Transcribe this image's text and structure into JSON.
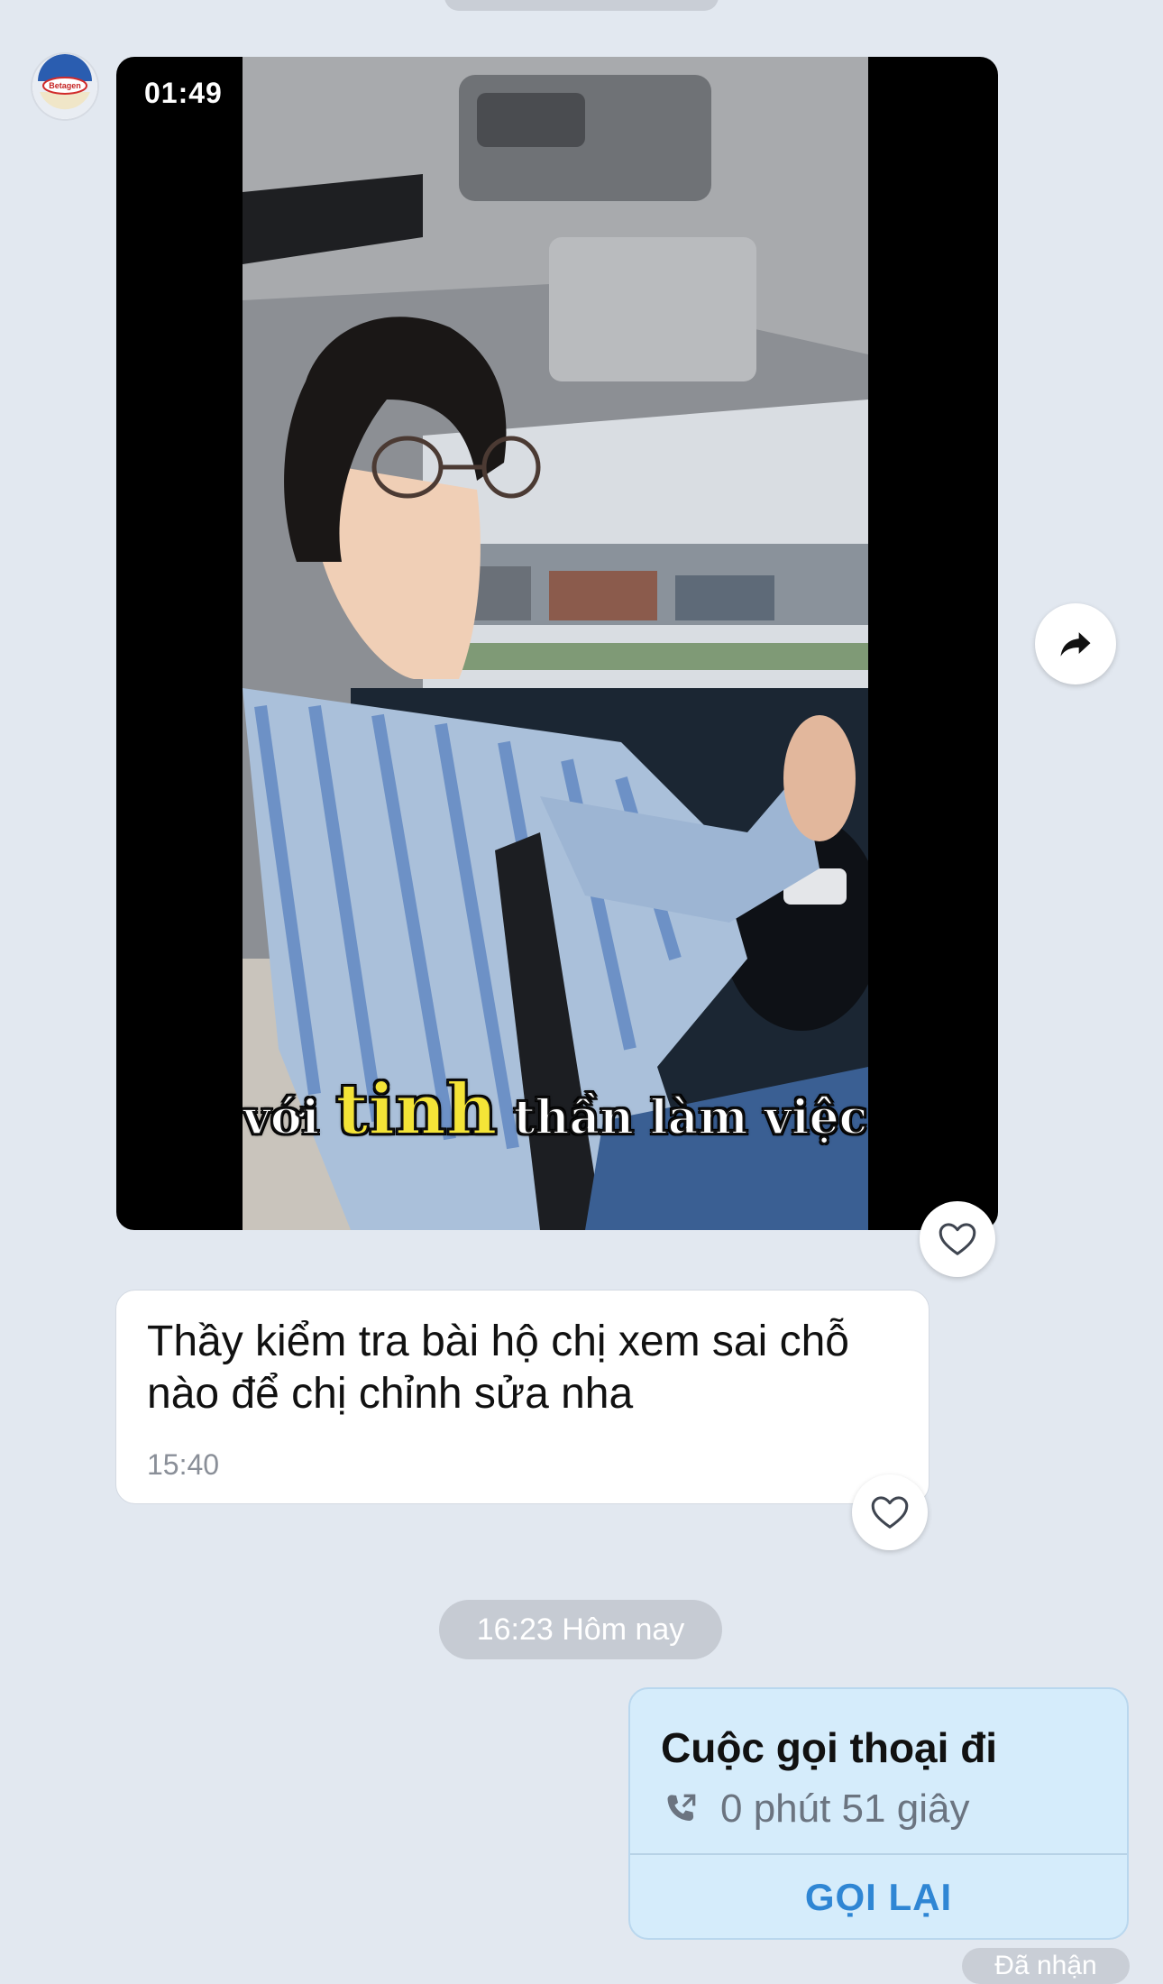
{
  "video": {
    "duration": "01:49",
    "caption_before": "với",
    "caption_highlight": "tinh",
    "caption_after": "thần làm việc"
  },
  "message": {
    "text": "Thầy kiểm tra bài hộ chị xem sai chỗ nào để chị chỉnh sửa nha",
    "time": "15:40"
  },
  "date_separator": "16:23 Hôm nay",
  "call": {
    "title": "Cuộc gọi thoại đi",
    "duration": "0 phút 51 giây",
    "action": "GỌI LẠI"
  },
  "status_pill": "Đã nhận",
  "avatar_logo_text": "Betagen",
  "icons": [
    "share-icon",
    "heart-icon",
    "outgoing-phone-icon"
  ],
  "colors": {
    "background": "#e2e8f0",
    "call_card_bg": "#d5ecfb",
    "call_action": "#2f86d4",
    "caption_highlight": "#f4e437"
  }
}
